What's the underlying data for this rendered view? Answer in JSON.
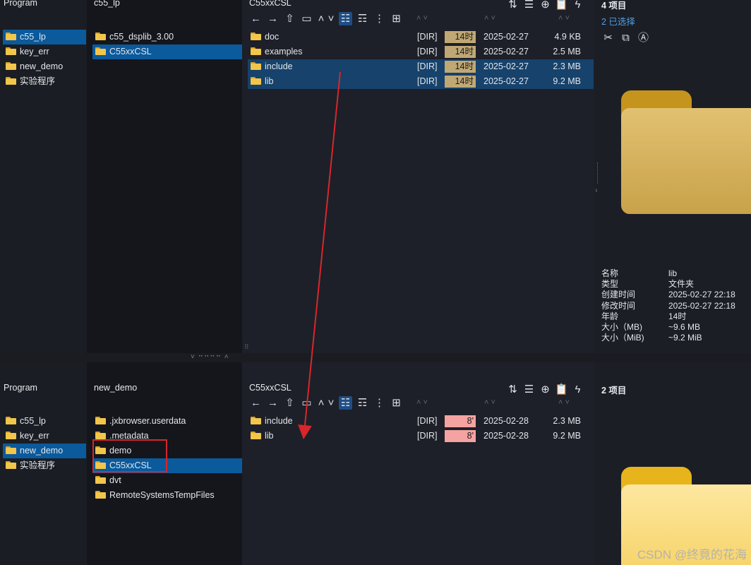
{
  "top": {
    "col1": {
      "header": "Program",
      "items": [
        {
          "label": "c55_lp",
          "selected": true
        },
        {
          "label": "key_err",
          "selected": false
        },
        {
          "label": "new_demo",
          "selected": false
        },
        {
          "label": "实验程序",
          "selected": false
        }
      ]
    },
    "col2": {
      "header": "c55_lp",
      "items": [
        {
          "label": "c55_dsplib_3.00",
          "selected": false
        },
        {
          "label": "C55xxCSL",
          "selected": true
        }
      ]
    },
    "col3": {
      "header": "C55xxCSL",
      "rows": [
        {
          "name": "doc",
          "type": "[DIR]",
          "age": "14时",
          "date": "2025-02-27",
          "size": "4.9 KB",
          "selected": false
        },
        {
          "name": "examples",
          "type": "[DIR]",
          "age": "14时",
          "date": "2025-02-27",
          "size": "2.5 MB",
          "selected": false
        },
        {
          "name": "include",
          "type": "[DIR]",
          "age": "14时",
          "date": "2025-02-27",
          "size": "2.3 MB",
          "selected": true
        },
        {
          "name": "lib",
          "type": "[DIR]",
          "age": "14时",
          "date": "2025-02-27",
          "size": "9.2 MB",
          "selected": true
        }
      ]
    },
    "preview": {
      "count": "4 项目",
      "selected": "2 已选择",
      "props": [
        {
          "k": "名称",
          "v": "lib"
        },
        {
          "k": "类型",
          "v": "文件夹"
        },
        {
          "k": "创建时间",
          "v": "2025-02-27  22:18"
        },
        {
          "k": "修改时间",
          "v": "2025-02-27  22:18"
        },
        {
          "k": "年龄",
          "v": "14时"
        },
        {
          "k": "大小（MB)",
          "v": "~9.6 MB"
        },
        {
          "k": "大小（MiB)",
          "v": "~9.2 MiB"
        }
      ]
    }
  },
  "bottom": {
    "col1": {
      "header": "Program",
      "items": [
        {
          "label": "c55_lp",
          "selected": false
        },
        {
          "label": "key_err",
          "selected": false
        },
        {
          "label": "new_demo",
          "selected": true
        },
        {
          "label": "实验程序",
          "selected": false
        }
      ]
    },
    "col2": {
      "header": "new_demo",
      "items": [
        {
          "label": ".jxbrowser.userdata",
          "selected": false
        },
        {
          "label": ".metadata",
          "selected": false
        },
        {
          "label": "demo",
          "selected": false
        },
        {
          "label": "C55xxCSL",
          "selected": true
        },
        {
          "label": "dvt",
          "selected": false
        },
        {
          "label": "RemoteSystemsTempFiles",
          "selected": false
        }
      ]
    },
    "col3": {
      "header": "C55xxCSL",
      "rows": [
        {
          "name": "include",
          "type": "[DIR]",
          "age": "8'",
          "date": "2025-02-28",
          "size": "2.3 MB",
          "selected": false
        },
        {
          "name": "lib",
          "type": "[DIR]",
          "age": "8'",
          "date": "2025-02-28",
          "size": "9.2 MB",
          "selected": false
        }
      ]
    },
    "preview": {
      "count": "2 项目"
    }
  },
  "colors": {
    "accent": "#0a5a9c",
    "age_old": "#c0a875",
    "age_new": "#f4a3a2",
    "annotation": "#d8262c"
  },
  "icons": {
    "toolbar": [
      "back-icon",
      "forward-icon",
      "up-icon",
      "new-folder-icon",
      "chevron-up-icon",
      "chevron-down-icon",
      "list-view-icon",
      "detail-view-icon",
      "tree-view-icon",
      "grid-view-icon"
    ],
    "tools": [
      "sort-icon",
      "filter-list-icon",
      "add-icon",
      "paste-icon",
      "flash-icon"
    ],
    "actions": [
      "cut-icon",
      "copy-icon",
      "rename-icon"
    ]
  },
  "watermark": "CSDN @终竟的花海"
}
